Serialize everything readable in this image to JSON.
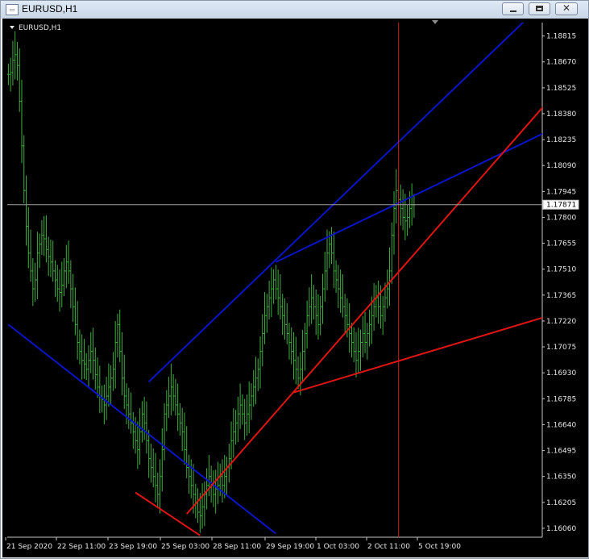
{
  "window": {
    "title": "EURUSD,H1"
  },
  "chart_data": {
    "type": "line",
    "symbol_label": "EURUSD,H1",
    "price_ticks": [
      "1.18815",
      "1.18670",
      "1.18525",
      "1.18380",
      "1.18235",
      "1.18090",
      "1.17945",
      "1.17800",
      "1.17655",
      "1.17510",
      "1.17365",
      "1.17220",
      "1.17075",
      "1.16930",
      "1.16785",
      "1.16640",
      "1.16495",
      "1.16350",
      "1.16205",
      "1.16060"
    ],
    "current_price": "1.17871",
    "time_ticks": [
      "21 Sep 2020",
      "22 Sep 11:00",
      "23 Sep 19:00",
      "25 Sep 03:00",
      "28 Sep 11:00",
      "29 Sep 19:00",
      "1 Oct 03:00",
      "2 Oct 11:00",
      "5 Oct 19:00"
    ],
    "ylim": [
      1.1601,
      1.1889
    ],
    "n_bars": 240,
    "cursor_bar": 175,
    "series": [
      {
        "values": [
          1.186,
          1.1861,
          1.1868,
          1.1871,
          1.1865,
          1.1845,
          1.182,
          1.1795,
          1.1775,
          1.176,
          1.175,
          1.174,
          1.1745,
          1.176,
          1.1765,
          1.177,
          1.1768,
          1.1762,
          1.1758,
          1.1755,
          1.175,
          1.1745,
          1.174,
          1.1738,
          1.1742,
          1.175,
          1.1755,
          1.175,
          1.174,
          1.173,
          1.172,
          1.171,
          1.1705,
          1.17,
          1.1698,
          1.1695,
          1.17,
          1.1705,
          1.17,
          1.1692,
          1.1685,
          1.168,
          1.1678,
          1.1675,
          1.168,
          1.1685,
          1.169,
          1.1695,
          1.171,
          1.172,
          1.1705,
          1.169,
          1.168,
          1.1675,
          1.167,
          1.1665,
          1.166,
          1.1655,
          1.165,
          1.166,
          1.167,
          1.1665,
          1.1655,
          1.1645,
          1.164,
          1.1635,
          1.163,
          1.1625,
          1.1635,
          1.165,
          1.167,
          1.1675,
          1.168,
          1.1685,
          1.168,
          1.1675,
          1.167,
          1.1665,
          1.166,
          1.165,
          1.164,
          1.1635,
          1.163,
          1.1625,
          1.162,
          1.1615,
          1.1613,
          1.1618,
          1.1625,
          1.163,
          1.1635,
          1.163,
          1.1625,
          1.1628,
          1.163,
          1.1635,
          1.163,
          1.1635,
          1.164,
          1.1645,
          1.1655,
          1.166,
          1.1665,
          1.167,
          1.1675,
          1.167,
          1.1665,
          1.167,
          1.1675,
          1.168,
          1.1685,
          1.169,
          1.1695,
          1.1705,
          1.1715,
          1.1725,
          1.173,
          1.1735,
          1.174,
          1.1745,
          1.174,
          1.1735,
          1.173,
          1.1725,
          1.172,
          1.1715,
          1.171,
          1.1705,
          1.17,
          1.1695,
          1.169,
          1.1695,
          1.1705,
          1.1715,
          1.1725,
          1.173,
          1.1735,
          1.173,
          1.1725,
          1.172,
          1.173,
          1.174,
          1.175,
          1.176,
          1.1765,
          1.176,
          1.175,
          1.1745,
          1.174,
          1.1735,
          1.173,
          1.1725,
          1.172,
          1.1715,
          1.171,
          1.1705,
          1.17,
          1.1705,
          1.171,
          1.1715,
          1.171,
          1.1715,
          1.172,
          1.1725,
          1.173,
          1.1735,
          1.173,
          1.1725,
          1.173,
          1.1735,
          1.174,
          1.175,
          1.177,
          1.1785,
          1.1795,
          1.179,
          1.1785,
          1.178,
          1.1778,
          1.178,
          1.1785,
          1.1787,
          1.17871
        ]
      }
    ],
    "trendlines": [
      {
        "color": "#0a14c8",
        "from": [
          0,
          1.172
        ],
        "to": [
          120,
          1.1603
        ],
        "name": "blue-down-line"
      },
      {
        "color": "#0a14c8",
        "from": [
          63,
          1.1688
        ],
        "to": [
          240,
          1.19
        ],
        "name": "blue-upper-line"
      },
      {
        "color": "#0a14c8",
        "from": [
          120,
          1.1755
        ],
        "to": [
          240,
          1.1827
        ],
        "name": "blue-lower-line"
      },
      {
        "color": "#e01414",
        "from": [
          57,
          1.1626
        ],
        "to": [
          86,
          1.1602
        ],
        "name": "red-short-line"
      },
      {
        "color": "#e01414",
        "from": [
          80,
          1.1614
        ],
        "to": [
          240,
          1.1842
        ],
        "name": "red-steep-line"
      },
      {
        "color": "#e01414",
        "from": [
          128,
          1.1682
        ],
        "to": [
          240,
          1.1724
        ],
        "name": "red-flat-line"
      }
    ],
    "colors": {
      "background": "#000000",
      "bars": "#3fae3f",
      "axis": "#c8c8c8",
      "price_line": "#a0a0a0",
      "cursor_line": "#d01010",
      "price_box": "#ffffff"
    }
  }
}
